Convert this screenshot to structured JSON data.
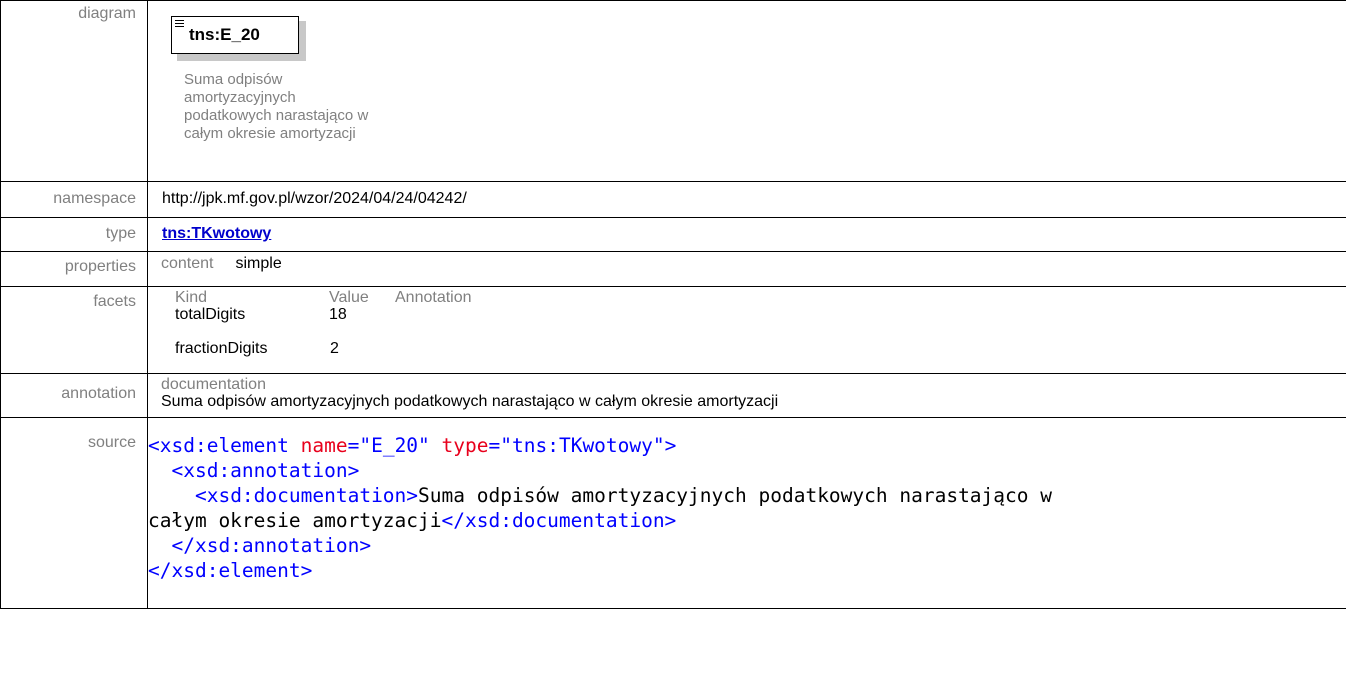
{
  "labels": {
    "diagram": "diagram",
    "namespace": "namespace",
    "type": "type",
    "properties": "properties",
    "facets": "facets",
    "annotation": "annotation",
    "source": "source"
  },
  "diagram": {
    "element_name": "tns:E_20",
    "doc_lines": [
      "Suma odpisów",
      "amortyzacyjnych",
      "podatkowych narastająco w",
      "całym okresie amortyzacji"
    ]
  },
  "namespace": "http://jpk.mf.gov.pl/wzor/2024/04/24/04242/",
  "type": {
    "link_text": "tns:TKwotowy"
  },
  "properties": {
    "key": "content",
    "value": "simple"
  },
  "facets": {
    "headers": {
      "kind": "Kind",
      "value": "Value",
      "annotation": "Annotation"
    },
    "rows": [
      {
        "kind": "totalDigits",
        "value": "18"
      },
      {
        "kind": "fractionDigits",
        "value": "2"
      }
    ]
  },
  "annotation": {
    "header": "documentation",
    "text": "Suma odpisów amortyzacyjnych podatkowych narastająco w całym okresie amortyzacji"
  },
  "source": {
    "l1_open": "<xsd:element ",
    "l1_attr1": "name",
    "l1_eq1": "=",
    "l1_val1": "\"E_20\"",
    "l1_attr2": "type",
    "l1_eq2": "=",
    "l1_val2": "\"tns:TKwotowy\"",
    "l1_close": ">",
    "l2": "<xsd:annotation>",
    "l3_open": "<xsd:documentation>",
    "l3_text": "Suma odpisów amortyzacyjnych podatkowych narastająco w",
    "l4_text": "całym okresie amortyzacji",
    "l4_close": "</xsd:documentation>",
    "l5": "</xsd:annotation>",
    "l6": "</xsd:element>"
  }
}
